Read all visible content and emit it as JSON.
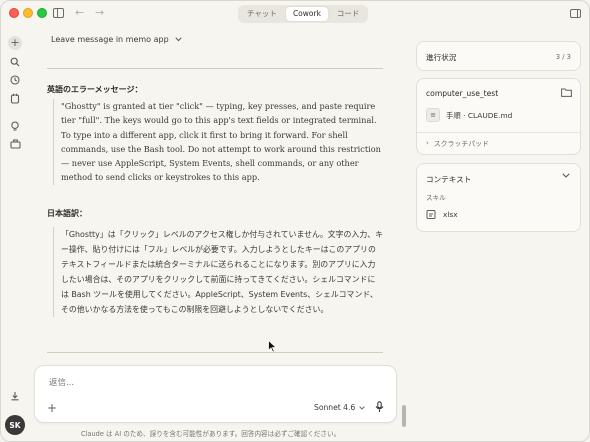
{
  "titlebar": {
    "tabs": [
      {
        "label": "チャット",
        "active": false
      },
      {
        "label": "Cowork",
        "active": true
      },
      {
        "label": "コード",
        "active": false
      }
    ]
  },
  "rail": {
    "icons": [
      "plus-icon",
      "search-icon",
      "clock-icon",
      "shield-icon",
      "lightbulb-icon",
      "briefcase-icon",
      "download-icon"
    ],
    "avatar_initials": "SK"
  },
  "main": {
    "conversation_title": "Leave message in memo app",
    "english_heading": "英語のエラーメッセージ：",
    "english_text": "\"Ghostty\" is granted at tier \"click\" — typing, key presses, and paste require tier \"full\". The keys would go to this app's text fields or integrated terminal. To type into a different app, click it first to bring it forward. For shell commands, use the Bash tool. Do not attempt to work around this restriction — never use AppleScript, System Events, shell commands, or any other method to send clicks or keystrokes to this app.",
    "japanese_heading": "日本語訳：",
    "japanese_text": "「Ghostty」は「クリック」レベルのアクセス権しか付与されていません。文字の入力、キー操作、貼り付けには「フル」レベルが必要です。入力しようとしたキーはこのアプリのテキストフィールドまたは統合ターミナルに送られることになります。別のアプリに入力したい場合は、そのアプリをクリックして前面に持ってきてください。シェルコマンドには Bash ツールを使用してください。AppleScript、System Events、シェルコマンド、その他いかなる方法を使ってもこの制限を回避しようとしないでください。"
  },
  "composer": {
    "placeholder": "返信...",
    "model": "Sonnet 4.6",
    "disclaimer": "Claude は AI のため、誤りを含む可能性があります。回答内容は必ずご確認ください。"
  },
  "right_panel": {
    "progress": {
      "title": "進行状況",
      "count": "3 / 3"
    },
    "folder": {
      "title": "computer_use_test",
      "file": "手順 · CLAUDE.md",
      "scratchpad": "スクラッチパッド"
    },
    "context": {
      "title": "コンテキスト",
      "skills_label": "スキル",
      "skill": "xlsx"
    }
  },
  "colors": {
    "background": "#f6f5f0",
    "card": "#fbfaf7",
    "avatar": "#3a3936"
  }
}
